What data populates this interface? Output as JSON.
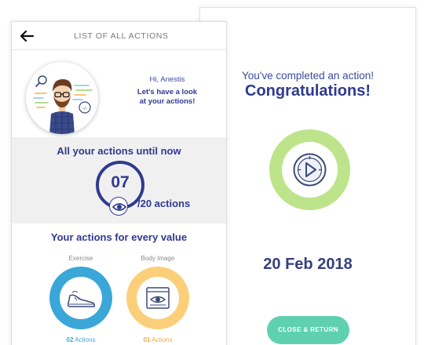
{
  "left_card": {
    "header": {
      "title": "LIST OF ALL ACTIONS",
      "back_icon": "arrow-left-icon"
    },
    "greeting": {
      "hello": "Hi, Anestis",
      "line1": "Let's have a look",
      "line2": "at your actions!"
    },
    "stats": {
      "title": "All your actions until now",
      "count": "07",
      "total": "/20 actions"
    },
    "values": {
      "title": "Your actions for every value",
      "items": [
        {
          "label": "Exercise",
          "count": "02",
          "unit": "Actions",
          "color": "#3aa7d8",
          "icon": "sneaker-icon"
        },
        {
          "label": "Body Image",
          "count": "01",
          "unit": "Actions",
          "color": "#fbcf7a",
          "icon": "eye-window-icon"
        }
      ]
    }
  },
  "right_card": {
    "subtitle": "You've completed an action!",
    "title": "Congratulations!",
    "ring_color": "#bde48a",
    "icon": "play-compass-icon",
    "date": "20 Feb 2018",
    "button_label": "CLOSE & RETURN",
    "button_color": "#5fd1b0"
  },
  "colors": {
    "primary": "#2f3a8f",
    "band": "#f0f0f0"
  }
}
